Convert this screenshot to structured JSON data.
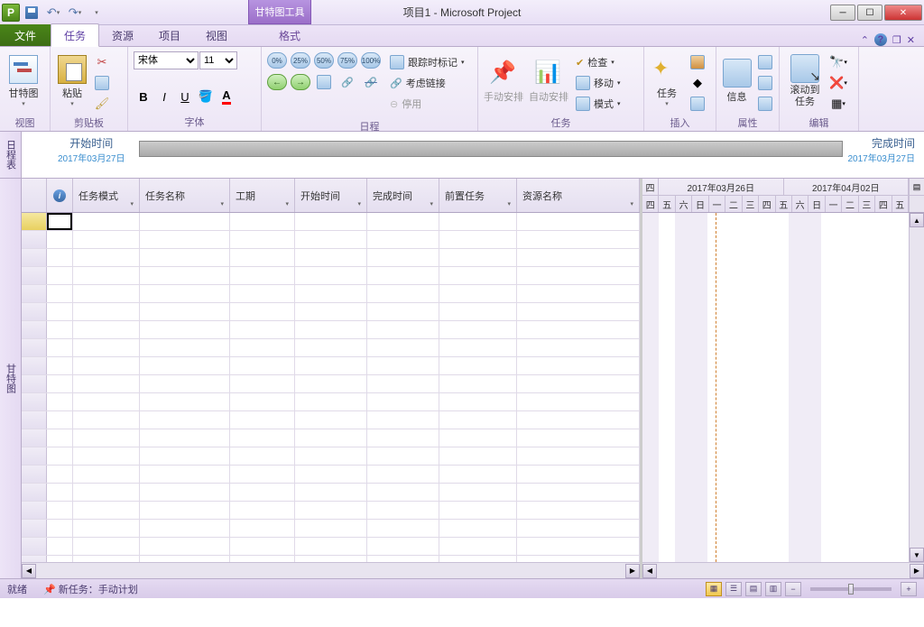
{
  "titlebar": {
    "contextual_label": "甘特图工具",
    "title": "项目1 - Microsoft Project"
  },
  "ribbon_tabs": {
    "file": "文件",
    "tabs": [
      "任务",
      "资源",
      "项目",
      "视图"
    ],
    "contextual": "格式",
    "active_index": 0
  },
  "ribbon": {
    "view": {
      "gantt_btn": "甘特图",
      "group": "视图"
    },
    "clipboard": {
      "paste_btn": "粘贴",
      "group": "剪贴板"
    },
    "font": {
      "name": "宋体",
      "size": "11",
      "group": "字体"
    },
    "schedule": {
      "track": "跟踪时标记",
      "respect": "考虑链接",
      "deactivate": "停用",
      "group": "日程",
      "pcts": [
        "0%",
        "25%",
        "50%",
        "75%",
        "100%"
      ]
    },
    "tasks": {
      "manual": "手动安排",
      "auto": "自动安排",
      "inspect": "检查",
      "move": "移动",
      "mode": "模式",
      "group": "任务"
    },
    "insert": {
      "task_btn": "任务",
      "group": "插入"
    },
    "properties": {
      "info_btn": "信息",
      "group": "属性"
    },
    "edit": {
      "scroll_btn": "滚动到\n任务",
      "group": "编辑"
    }
  },
  "timeline": {
    "tab": "日程表",
    "start_label": "开始时间",
    "start_date": "2017年03月27日",
    "end_label": "完成时间",
    "end_date": "2017年03月27日"
  },
  "grid": {
    "side_tab": "甘特图",
    "columns": [
      "任务模式",
      "任务名称",
      "工期",
      "开始时间",
      "完成时间",
      "前置任务",
      "资源名称"
    ]
  },
  "gantt_timescale": {
    "weeks": [
      "2017年03月26日",
      "2017年04月02日"
    ],
    "first_partial_day": "四",
    "days": [
      "四",
      "五",
      "六",
      "日",
      "一",
      "二",
      "三",
      "四",
      "五",
      "六",
      "日",
      "一",
      "二",
      "三",
      "四",
      "五"
    ]
  },
  "statusbar": {
    "ready": "就绪",
    "new_task": "新任务：手动计划"
  }
}
